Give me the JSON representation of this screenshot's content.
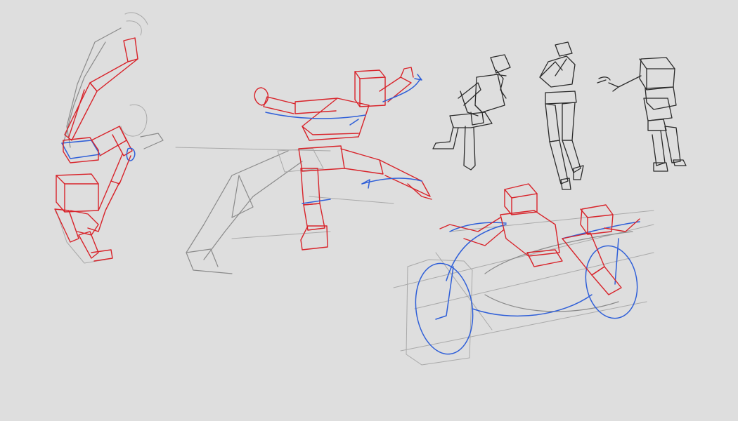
{
  "canvas": {
    "background": "#dedede",
    "colors": {
      "construction": "#8a8a8a",
      "mannequin": "#d8232a",
      "gesture": "#2f5fd8",
      "ink": "#2a2a2a"
    }
  },
  "sketches": [
    {
      "name": "falling-figure-sketch"
    },
    {
      "name": "lunging-figure-sketch"
    },
    {
      "name": "sitting-figure-sketch"
    },
    {
      "name": "standing-figure-sketch"
    },
    {
      "name": "bent-figure-sketch"
    },
    {
      "name": "motorcycle-rider-sketch"
    }
  ]
}
